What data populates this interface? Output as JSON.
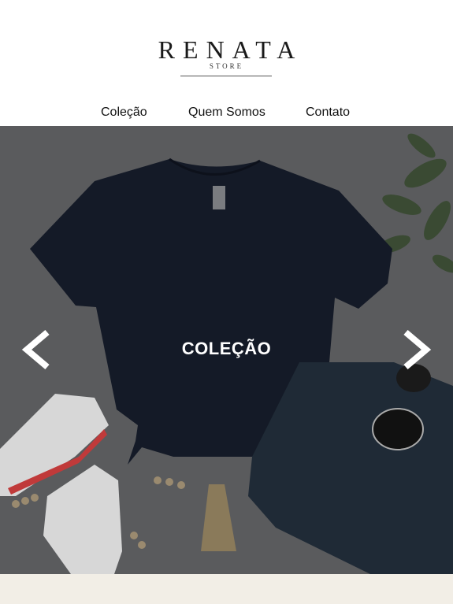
{
  "brand": {
    "name": "RENATA",
    "subtitle": "STORE"
  },
  "nav": {
    "items": [
      "Coleção",
      "Quem Somos",
      "Contato"
    ]
  },
  "hero": {
    "title": "COLEÇÃO"
  },
  "colors": {
    "overlay": "#57585a",
    "shirt": "#141a27",
    "footer_band": "#f2eee6"
  },
  "icons": {
    "prev": "chevron-left-icon",
    "next": "chevron-right-icon"
  }
}
